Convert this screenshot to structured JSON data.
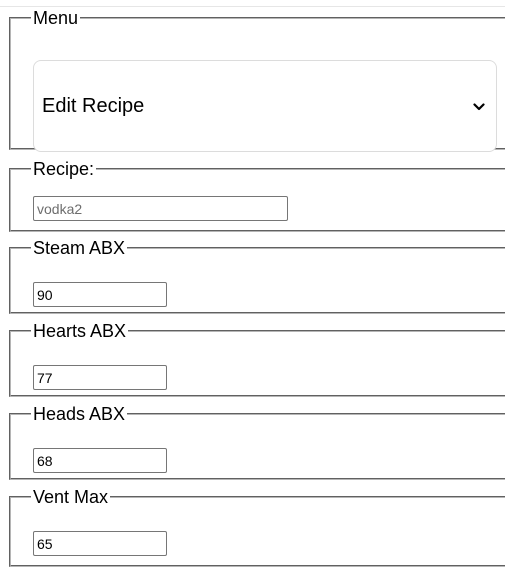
{
  "menu": {
    "legend": "Menu",
    "selected": "Edit Recipe"
  },
  "fields": {
    "recipe": {
      "legend": "Recipe:",
      "value": "vodka2"
    },
    "steam_abx": {
      "legend": "Steam ABX",
      "value": "90"
    },
    "hearts_abx": {
      "legend": "Hearts ABX",
      "value": "77"
    },
    "heads_abx": {
      "legend": "Heads ABX",
      "value": "68"
    },
    "vent_max": {
      "legend": "Vent Max",
      "value": "65"
    }
  }
}
